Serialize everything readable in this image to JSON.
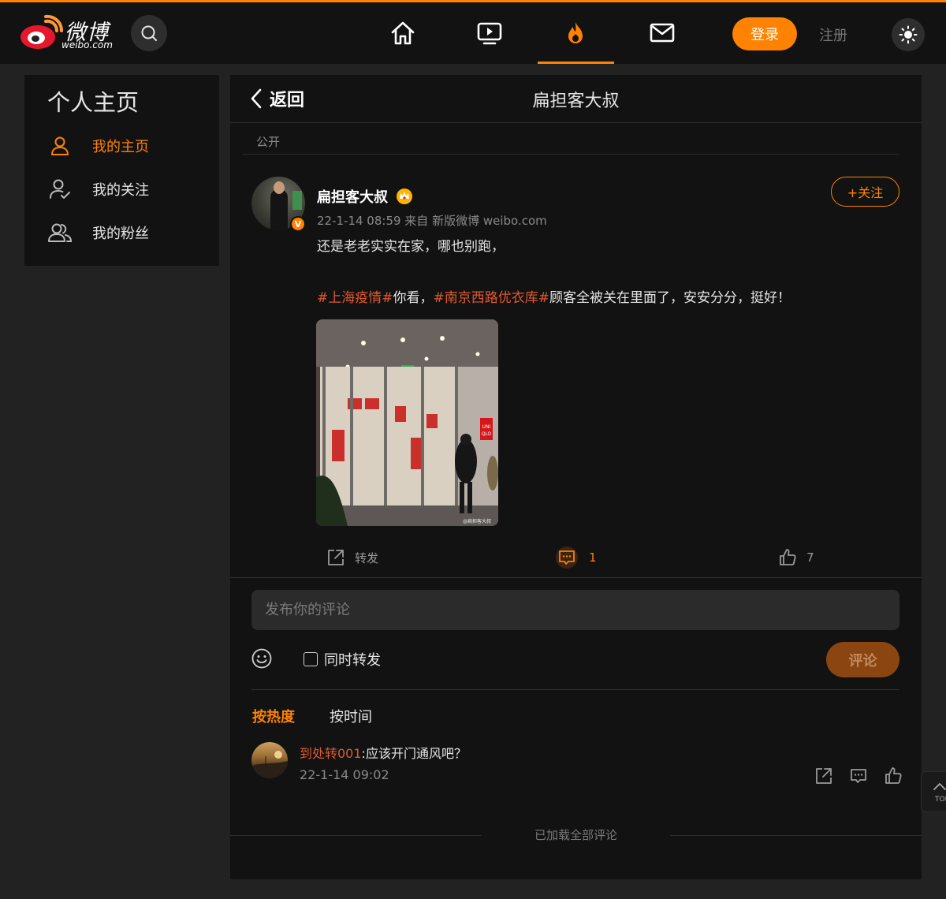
{
  "header": {
    "logo_text": "微博",
    "logo_sub": "weibo.com",
    "login_label": "登录",
    "register_label": "注册",
    "nav": [
      "home-icon",
      "video-icon",
      "hot-icon",
      "mail-icon"
    ],
    "active_nav": "hot"
  },
  "sidebar": {
    "title": "个人主页",
    "items": [
      {
        "label": "我的主页",
        "icon": "user-icon",
        "active": true
      },
      {
        "label": "我的关注",
        "icon": "user-check-icon",
        "active": false
      },
      {
        "label": "我的粉丝",
        "icon": "users-icon",
        "active": false
      }
    ]
  },
  "main": {
    "back_label": "返回",
    "title": "扁担客大叔",
    "visibility": "公开",
    "post": {
      "author": "扁担客大叔",
      "verified_badge": "V",
      "meta": "22-1-14 08:59  来自 新版微博 weibo.com",
      "follow_label": "+关注",
      "line1": "还是老老实实在家，哪也别跑，",
      "topic1": "#上海疫情#",
      "seg1": "你看，",
      "topic2": "#南京西路优衣库#",
      "seg2": "顾客全被关在里面了，安安分分，挺好！",
      "image_watermark": "@扁担客大叔"
    },
    "actions": {
      "repost_label": "转发",
      "comment_count": "1",
      "like_count": "7"
    },
    "comment_form": {
      "placeholder": "发布你的评论",
      "repost_label": "同时转发",
      "submit_label": "评论"
    },
    "sort": {
      "hot": "按热度",
      "time": "按时间"
    },
    "comments": [
      {
        "user": "到处转001",
        "text": ":应该开门通风吧？",
        "time": "22-1-14 09:02"
      }
    ],
    "end_text": "已加载全部评论"
  },
  "to_top_label": "TOP",
  "colors": {
    "accent": "#ff8200",
    "topic": "#e0592e",
    "bg": "#222222",
    "panel": "#121212"
  }
}
